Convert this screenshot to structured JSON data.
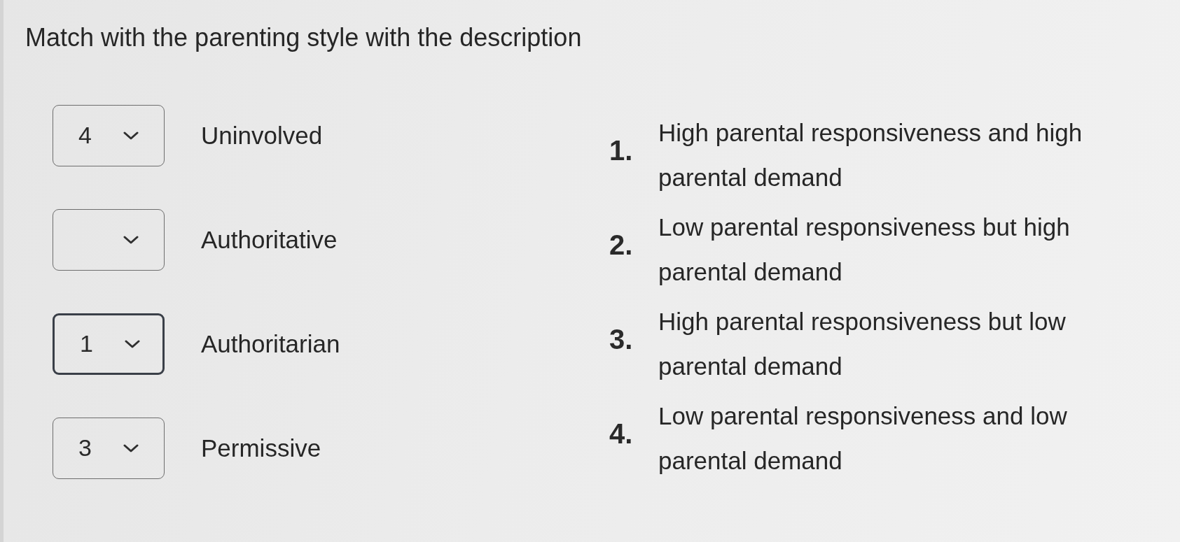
{
  "question": {
    "title": "Match with the parenting style with the description"
  },
  "matches": [
    {
      "value": "4",
      "label": "Uninvolved",
      "focused": false
    },
    {
      "label": "Authoritative",
      "focused": false
    },
    {
      "value": "1",
      "label": "Authoritarian",
      "focused": true
    },
    {
      "value": "3",
      "label": "Permissive",
      "focused": false
    }
  ],
  "options": [
    {
      "number": "1.",
      "text": "High parental responsiveness and high parental demand"
    },
    {
      "number": "2.",
      "text": "Low parental responsiveness but high parental demand"
    },
    {
      "number": "3.",
      "text": "High parental responsiveness but low parental demand"
    },
    {
      "number": "4.",
      "text": "Low parental responsiveness and low parental demand"
    }
  ]
}
